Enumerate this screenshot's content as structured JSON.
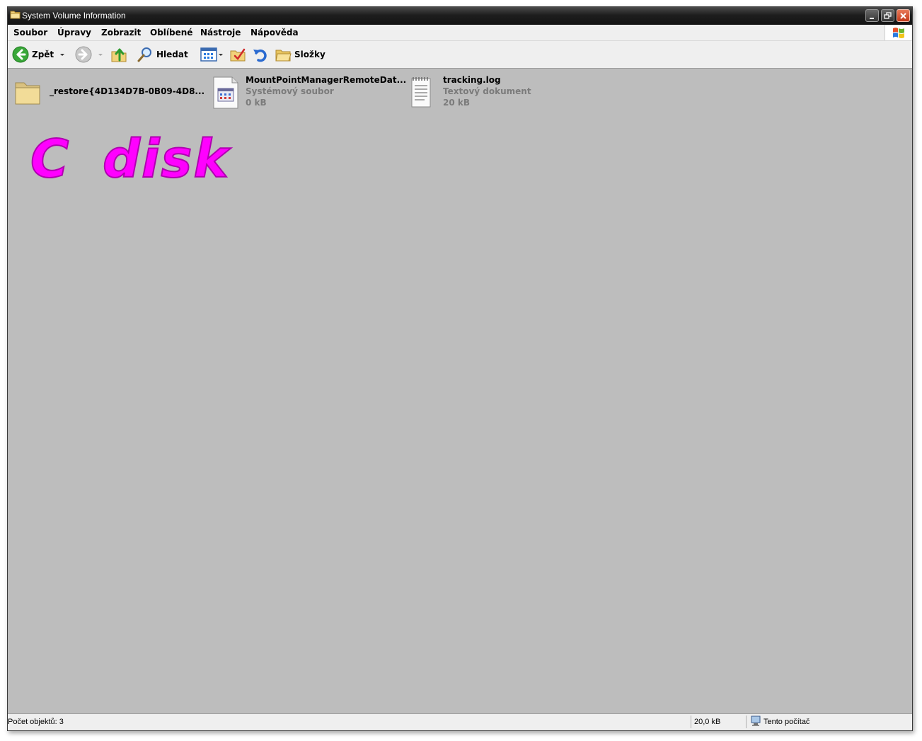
{
  "window": {
    "title": "System Volume Information"
  },
  "menu": {
    "items": [
      "Soubor",
      "Úpravy",
      "Zobrazit",
      "Oblíbené",
      "Nástroje",
      "Nápověda"
    ]
  },
  "toolbar": {
    "back_label": "Zpět",
    "search_label": "Hledat",
    "folders_label": "Složky"
  },
  "files": [
    {
      "name": "_restore{4D134D7B-0B09-4D8...",
      "type": "",
      "size": "",
      "icon": "folder-icon"
    },
    {
      "name": "MountPointManagerRemoteDat...",
      "type": "Systémový soubor",
      "size": "0 kB",
      "icon": "system-file-icon"
    },
    {
      "name": "tracking.log",
      "type": "Textový dokument",
      "size": "20 kB",
      "icon": "text-document-icon"
    }
  ],
  "annotation": {
    "text": "C disk",
    "color": "#ff00ff"
  },
  "status": {
    "count": "Počet objektů: 3",
    "size": "20,0 kB",
    "location": "Tento počítač"
  }
}
